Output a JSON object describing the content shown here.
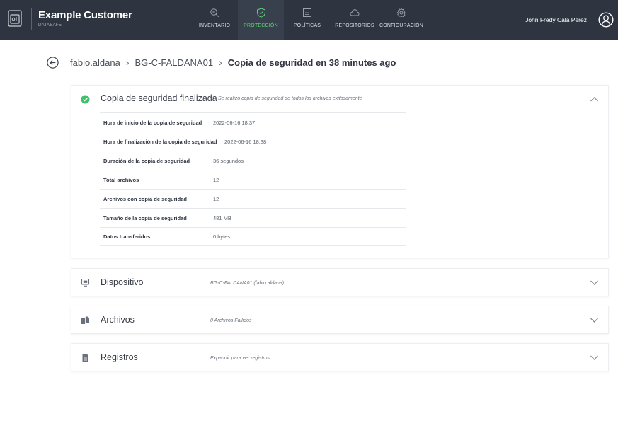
{
  "header": {
    "title": "Example Customer",
    "subtitle": "DATASAFE",
    "nav": [
      {
        "label": "INVENTARIO",
        "icon": "search-icon"
      },
      {
        "label": "PROTECCIÓN",
        "icon": "shield-icon",
        "active": true
      },
      {
        "label": "POLÍTICAS",
        "icon": "list-icon"
      },
      {
        "label": "REPOSITORIOS",
        "icon": "cloud-icon"
      },
      {
        "label": "CONFIGURACIÓN",
        "icon": "gear-icon"
      }
    ],
    "user_name": "John Fredy Cala Perez",
    "colors": {
      "bar": "#2e3440",
      "accent": "#5fd27a"
    }
  },
  "breadcrumb": {
    "user": "fabio.aldana",
    "device": "BG-C-FALDANA01",
    "current": "Copia de seguridad en 38 minutes ago"
  },
  "backup_card": {
    "title": "Copia de seguridad finalizada",
    "subtitle": "Se realizó copia de seguridad de todos los archivos exitosamente",
    "rows": [
      {
        "label": "Hora de inicio de la copia de seguridad",
        "value": "2022-06-16 18:37"
      },
      {
        "label": "Hora de finalización de la copia de seguridad",
        "value": "2022-06-16 18:38"
      },
      {
        "label": "Duración de la copia de seguridad",
        "value": "36 segundos"
      },
      {
        "label": "Total archivos",
        "value": "12"
      },
      {
        "label": "Archivos con copia de seguridad",
        "value": "12"
      },
      {
        "label": "Tamaño de la copia de seguridad",
        "value": "481 MB"
      },
      {
        "label": "Datos transferidos",
        "value": "0 bytes"
      }
    ]
  },
  "device_card": {
    "title": "Dispositivo",
    "subtitle": "BG-C-FALDANA01 (fabio.aldana)"
  },
  "files_card": {
    "title": "Archivos",
    "subtitle": "0 Archivos Fallidos"
  },
  "logs_card": {
    "title": "Registros",
    "subtitle": "Expandir para ver registros"
  }
}
